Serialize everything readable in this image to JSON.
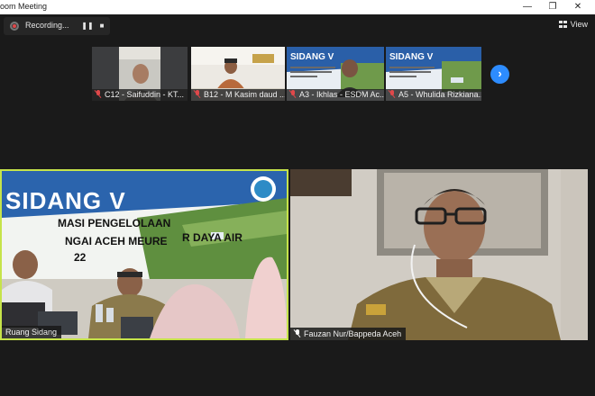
{
  "window": {
    "title": "oom Meeting",
    "minimize": "—",
    "restore": "❐",
    "close": "✕"
  },
  "recording": {
    "label": "Recording...",
    "pause_icon": "pause-icon",
    "stop_icon": "stop-icon"
  },
  "view": {
    "label": "View",
    "icon": "grid-icon"
  },
  "thumbnails": [
    {
      "name": "C12 - Saifuddin - KT...",
      "muted": true
    },
    {
      "name": "B12 - M Kasim daud ...",
      "muted": true
    },
    {
      "name": "A3 - Ikhlas - ESDM Ac...",
      "muted": true,
      "slide_title": "SIDANG V"
    },
    {
      "name": "A5 - Whulida Rizkiana...",
      "muted": true,
      "slide_title": "SIDANG V"
    }
  ],
  "next_page": {
    "icon": "chevron-right-icon",
    "glyph": "›"
  },
  "tiles": [
    {
      "name": "Ruang Sidang",
      "slide_title": "SIDANG V",
      "slide_line1": "MASI PENGELOLAAN",
      "slide_line2": "R DAYA AIR",
      "slide_line3": "NGAI ACEH MEURE",
      "slide_line4": "22",
      "active_speaker": true,
      "accent": "#c6e34a"
    },
    {
      "name": "Fauzan Nur/Bappeda Aceh",
      "muted": false
    }
  ]
}
